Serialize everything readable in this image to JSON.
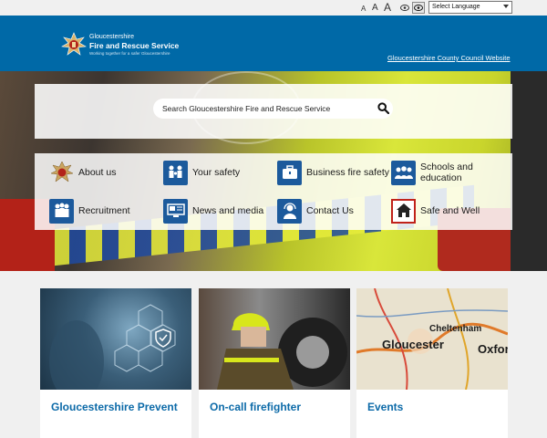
{
  "topbar": {
    "font_small": "A",
    "font_medium": "A",
    "font_large": "A",
    "language_select": "Select Language"
  },
  "header": {
    "logo_line1": "Gloucestershire",
    "logo_line2": "Fire and Rescue Service",
    "logo_tagline": "Working together for a safer Gloucestershire",
    "council_link": "Gloucestershire County Council Website"
  },
  "search": {
    "placeholder": "Search Gloucestershire Fire and Rescue Service"
  },
  "tiles": [
    {
      "label": "About us",
      "icon": "badge-icon"
    },
    {
      "label": "Your safety",
      "icon": "family-icon"
    },
    {
      "label": "Business fire safety",
      "icon": "briefcase-icon"
    },
    {
      "label": "Schools and education",
      "icon": "students-icon"
    },
    {
      "label": "Recruitment",
      "icon": "people-icon"
    },
    {
      "label": "News and media",
      "icon": "monitor-icon"
    },
    {
      "label": "Contact Us",
      "icon": "headset-icon"
    },
    {
      "label": "Safe and Well",
      "icon": "house-icon"
    }
  ],
  "cards": [
    {
      "title": "Gloucestershire Prevent"
    },
    {
      "title": "On-call firefighter"
    },
    {
      "title": "Events"
    }
  ],
  "map_labels": {
    "gloucester": "Gloucester",
    "cheltenham": "Cheltenham",
    "oxford": "Oxfor"
  },
  "colors": {
    "brand_blue": "#0069a7",
    "link_blue": "#0c6aa8",
    "icon_blue": "#1c5a9c"
  }
}
